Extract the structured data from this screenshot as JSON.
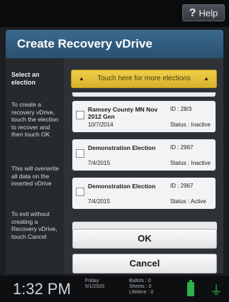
{
  "topbar": {
    "help_label": "Help",
    "help_icon": "?"
  },
  "header": {
    "title": "Create Recovery vDrive"
  },
  "sidebar": {
    "heading": "Select an election",
    "instruction_1": "To create a recovery vDrive, touch the election to recover and then touch OK",
    "instruction_2": "This will overwrite all data on the inserted vDrive",
    "instruction_3": "To exit without creating a Recovery vDrive, touch Cancel"
  },
  "more_options": {
    "label": "Touch here for more elections"
  },
  "elections": [
    {
      "name": "Ramsey County MN Nov 2012 Gen",
      "id": "ID : 28/3",
      "date": "10/7/2014",
      "status": "Status : Inactive"
    },
    {
      "name": "Demonstration Election",
      "id": "ID : 2967",
      "date": "7/4/2015",
      "status": "Status : Inactive"
    },
    {
      "name": "Demonstration Election",
      "id": "ID : 2967",
      "date": "7/4/2015",
      "status": "Status : Active"
    }
  ],
  "buttons": {
    "ok": "OK",
    "cancel": "Cancel"
  },
  "statusbar": {
    "time": "1:32 PM",
    "day": "Friday",
    "date": "5/1/2020",
    "ballots_label": "Ballots : 0",
    "sheets_label": "Sheets : 0",
    "lifetime_label": "Lifetime : 0"
  },
  "colors": {
    "accent_yellow": "#e3bd36",
    "header_blue": "#33607f",
    "battery_green": "#2bb24c"
  }
}
